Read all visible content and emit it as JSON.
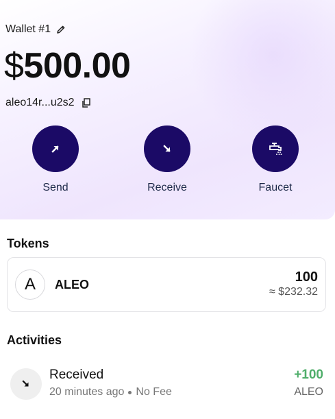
{
  "wallet": {
    "name": "Wallet #1",
    "balance_currency": "$",
    "balance_amount": "500.00",
    "address": "aleo14r...u2s2"
  },
  "actions": [
    {
      "label": "Send",
      "icon": "arrow-up-right-icon"
    },
    {
      "label": "Receive",
      "icon": "arrow-down-right-icon"
    },
    {
      "label": "Faucet",
      "icon": "faucet-icon"
    }
  ],
  "tokens": {
    "title": "Tokens",
    "items": [
      {
        "logo": "A",
        "symbol": "ALEO",
        "amount": "100",
        "fiat": "≈ $232.32"
      }
    ]
  },
  "activities": {
    "title": "Activities",
    "items": [
      {
        "type": "Received",
        "time": "20 minutes ago",
        "fee": "No Fee",
        "amount": "+100",
        "unit": "ALEO",
        "icon": "arrow-down-right-icon"
      }
    ]
  },
  "colors": {
    "primary": "#1b0a66",
    "positive": "#4fae6a"
  }
}
